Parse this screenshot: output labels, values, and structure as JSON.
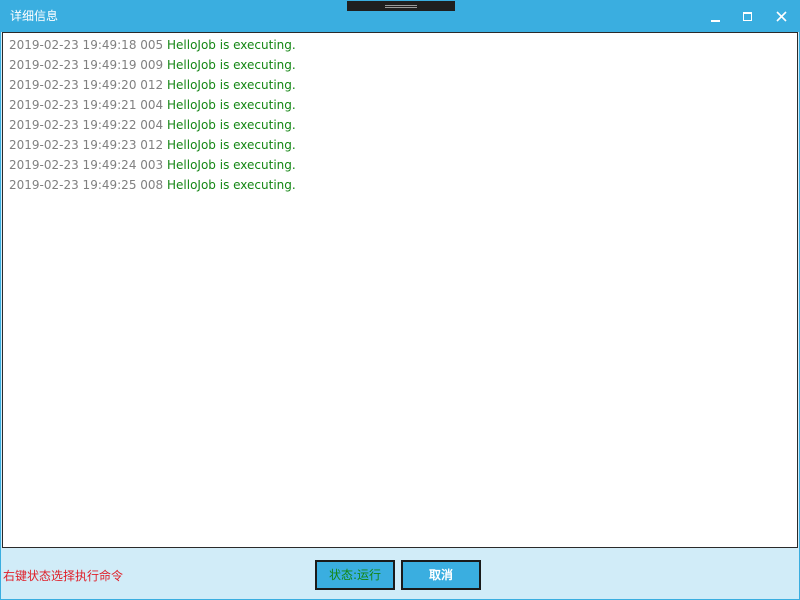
{
  "window": {
    "title": "详细信息"
  },
  "log": {
    "entries": [
      {
        "time": "2019-02-23 19:49:18 005",
        "message": "HelloJob is executing."
      },
      {
        "time": "2019-02-23 19:49:19 009",
        "message": "HelloJob is executing."
      },
      {
        "time": "2019-02-23 19:49:20 012",
        "message": "HelloJob is executing."
      },
      {
        "time": "2019-02-23 19:49:21 004",
        "message": "HelloJob is executing."
      },
      {
        "time": "2019-02-23 19:49:22 004",
        "message": "HelloJob is executing."
      },
      {
        "time": "2019-02-23 19:49:23 012",
        "message": "HelloJob is executing."
      },
      {
        "time": "2019-02-23 19:49:24 003",
        "message": "HelloJob is executing."
      },
      {
        "time": "2019-02-23 19:49:25 008",
        "message": "HelloJob is executing."
      }
    ]
  },
  "footer": {
    "hint": "右键状态选择执行命令",
    "status_label": "状态:运行",
    "cancel_label": "取消"
  },
  "icons": {
    "minimize": "minimize-icon",
    "maximize": "maximize-icon",
    "close": "close-icon",
    "grip": "drag-grip-icon"
  },
  "colors": {
    "accent": "#3aaee0",
    "footer_bg": "#d1ecf8",
    "log_time": "#808080",
    "log_message": "#148614",
    "hint": "#e0202a"
  }
}
